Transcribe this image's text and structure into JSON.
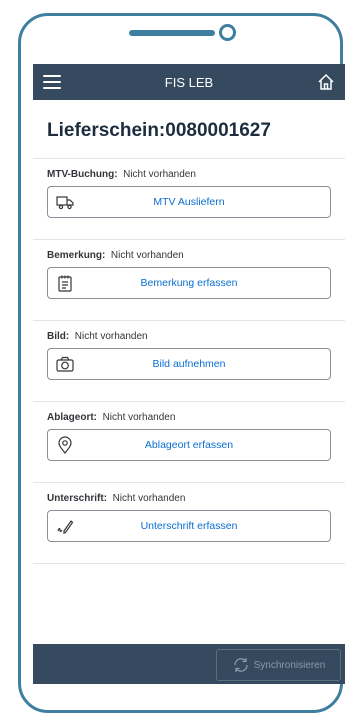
{
  "header": {
    "title": "FIS LEB"
  },
  "page": {
    "title": "Lieferschein:0080001627"
  },
  "sections": [
    {
      "label": "MTV-Buchung:",
      "status": "Nicht vorhanden",
      "button": "MTV Ausliefern",
      "icon": "truck-icon"
    },
    {
      "label": "Bemerkung:",
      "status": "Nicht vorhanden",
      "button": "Bemerkung erfassen",
      "icon": "notepad-icon"
    },
    {
      "label": "Bild:",
      "status": "Nicht vorhanden",
      "button": "Bild aufnehmen",
      "icon": "camera-icon"
    },
    {
      "label": "Ablageort:",
      "status": "Nicht vorhanden",
      "button": "Ablageort erfassen",
      "icon": "location-pin-icon"
    },
    {
      "label": "Unterschrift:",
      "status": "Nicht vorhanden",
      "button": "Unterschrift erfassen",
      "icon": "signature-icon"
    }
  ],
  "footer": {
    "sync_label": "Synchronisieren"
  },
  "colors": {
    "shell": "#354a5f",
    "accent": "#0a6ed1",
    "frame": "#3e7fa0"
  }
}
